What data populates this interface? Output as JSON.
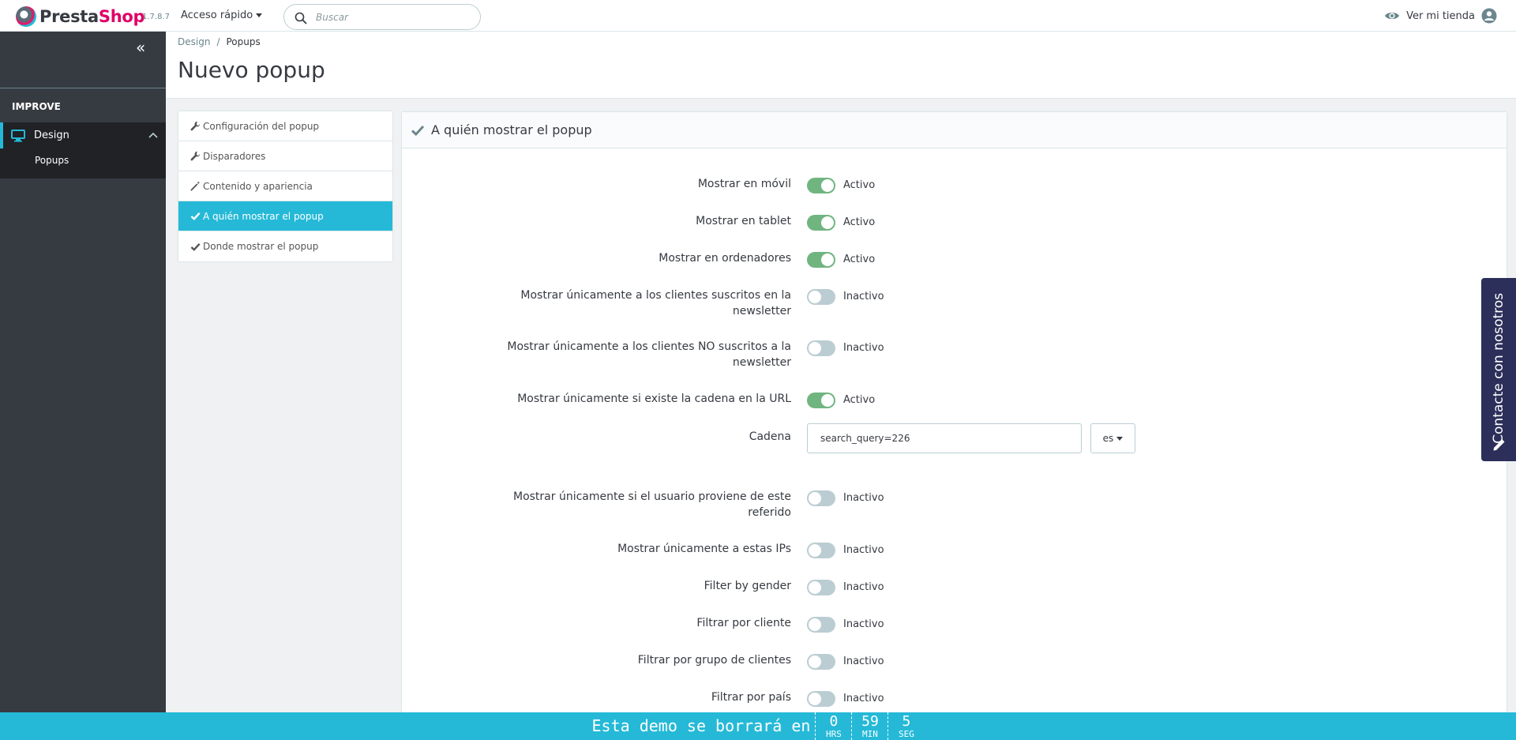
{
  "header": {
    "brand_presta": "Presta",
    "brand_shop": "Shop",
    "version": "1.7.8.7",
    "quick_access": "Acceso rápido",
    "search_placeholder": "Buscar",
    "view_store": "Ver mi tienda"
  },
  "sidebar": {
    "section": "IMPROVE",
    "items": [
      {
        "label": "Design",
        "icon": "monitor-icon",
        "expanded": true
      },
      {
        "label": "Popups"
      }
    ]
  },
  "breadcrumb": {
    "parent": "Design",
    "separator": "/",
    "current": "Popups"
  },
  "page_title": "Nuevo popup",
  "tabs": [
    {
      "label": "Configuración del popup",
      "icon": "wrench-icon",
      "active": false
    },
    {
      "label": "Disparadores",
      "icon": "wrench-icon",
      "active": false
    },
    {
      "label": "Contenido y apariencia",
      "icon": "magic-wand-icon",
      "active": false
    },
    {
      "label": "A quién mostrar el popup",
      "icon": "check-icon",
      "active": true
    },
    {
      "label": "Donde mostrar el popup",
      "icon": "check-icon",
      "active": false
    }
  ],
  "panel": {
    "title": "A quién mostrar el popup",
    "active_label": "Activo",
    "inactive_label": "Inactivo",
    "fields": [
      {
        "label": "Mostrar en móvil",
        "enabled": true
      },
      {
        "label": "Mostrar en tablet",
        "enabled": true
      },
      {
        "label": "Mostrar en ordenadores",
        "enabled": true
      },
      {
        "label": "Mostrar únicamente a los clientes suscritos en la newsletter",
        "enabled": false
      },
      {
        "label": "Mostrar únicamente a los clientes NO suscritos a la newsletter",
        "enabled": false
      },
      {
        "label": "Mostrar únicamente si existe la cadena en la URL",
        "enabled": true
      },
      {
        "label": "Mostrar únicamente si el usuario proviene de este referido",
        "enabled": false
      },
      {
        "label": "Mostrar únicamente a estas IPs",
        "enabled": false
      },
      {
        "label": "Filter by gender",
        "enabled": false
      },
      {
        "label": "Filtrar por cliente",
        "enabled": false
      },
      {
        "label": "Filtrar por grupo de clientes",
        "enabled": false
      },
      {
        "label": "Filtrar por país",
        "enabled": false
      }
    ],
    "cadena": {
      "label": "Cadena",
      "value": "search_query=226",
      "lang": "es"
    }
  },
  "contact_tab": "Contacte con nosotros",
  "demo_bar": {
    "message": "Esta demo se borrará en",
    "hours": "0",
    "hours_label": "HRS",
    "minutes": "59",
    "minutes_label": "MIN",
    "seconds": "5",
    "seconds_label": "SEG"
  },
  "colors": {
    "accent": "#25b9d7",
    "sidebar": "#363a41",
    "switch_on": "#70b580",
    "switch_off": "#bbcdd2",
    "brand_pink": "#df0067",
    "contact_tab": "#2c2f5a"
  }
}
